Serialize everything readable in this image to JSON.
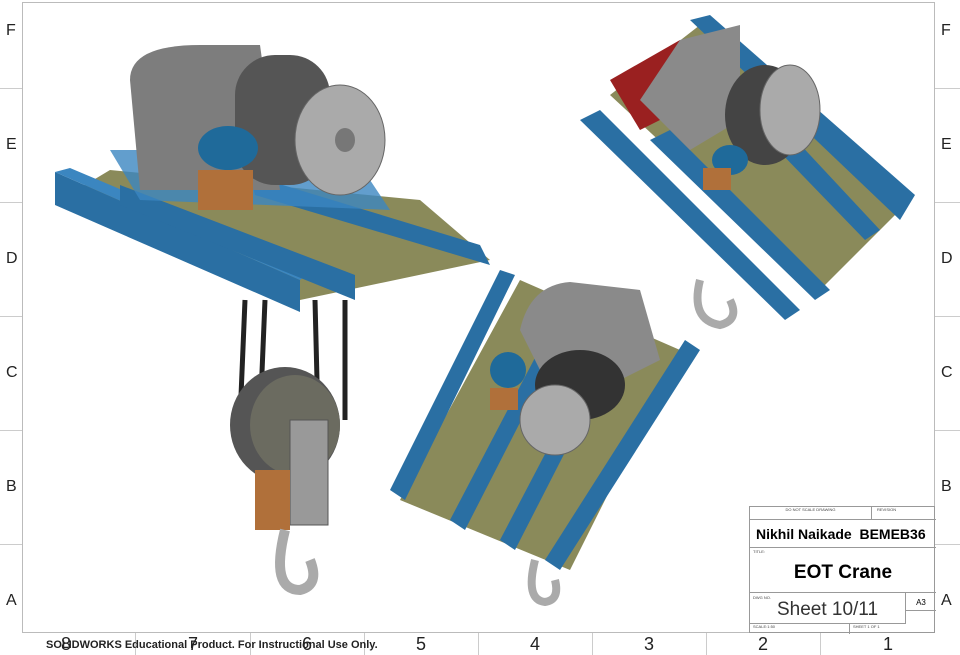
{
  "rows": [
    "F",
    "E",
    "D",
    "C",
    "B",
    "A"
  ],
  "columns": [
    "8",
    "7",
    "6",
    "5",
    "4",
    "3",
    "2",
    "1"
  ],
  "title_block": {
    "do_not_scale": "DO NOT SCALE DRAWING",
    "revision": "REVISION",
    "author": "Nikhil Naikade  BEMEB36",
    "title_label": "TITLE:",
    "title": "EOT Crane",
    "dwg_no_label": "DWG NO.",
    "dwg_no": "Sheet 10/11",
    "size": "A3",
    "scale": "SCALE:1:50",
    "sheet": "SHEET 1 OF 1"
  },
  "watermark": "SOLIDWORKS Educational Product. For Instructional Use Only.",
  "colors": {
    "beam": "#2a6fa3",
    "motor": "#777",
    "base": "#8a8a5a",
    "gearbox": "#b0703a",
    "drum": "#333"
  }
}
